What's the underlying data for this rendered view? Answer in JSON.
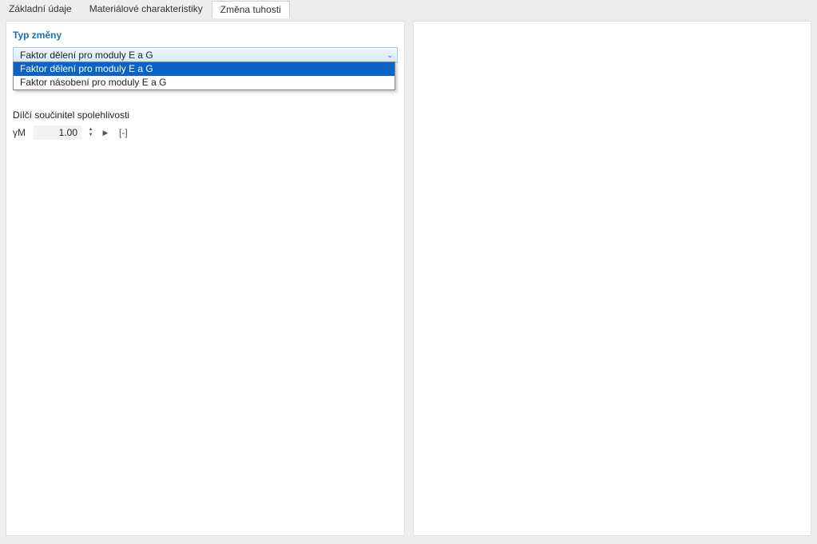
{
  "tabs": {
    "t0": "Základní údaje",
    "t1": "Materiálové charakteristiky",
    "t2": "Změna tuhosti"
  },
  "section": {
    "title": "Typ změny",
    "combo_value": "Faktor dělení pro moduly E a G",
    "options": {
      "o0": "Faktor dělení pro moduly E a G",
      "o1": "Faktor násobení pro moduly E a G"
    }
  },
  "reliability": {
    "label": "Dílčí součinitel spolehlivosti",
    "symbol": "γM",
    "value": "1.00",
    "unit": "[-]"
  }
}
